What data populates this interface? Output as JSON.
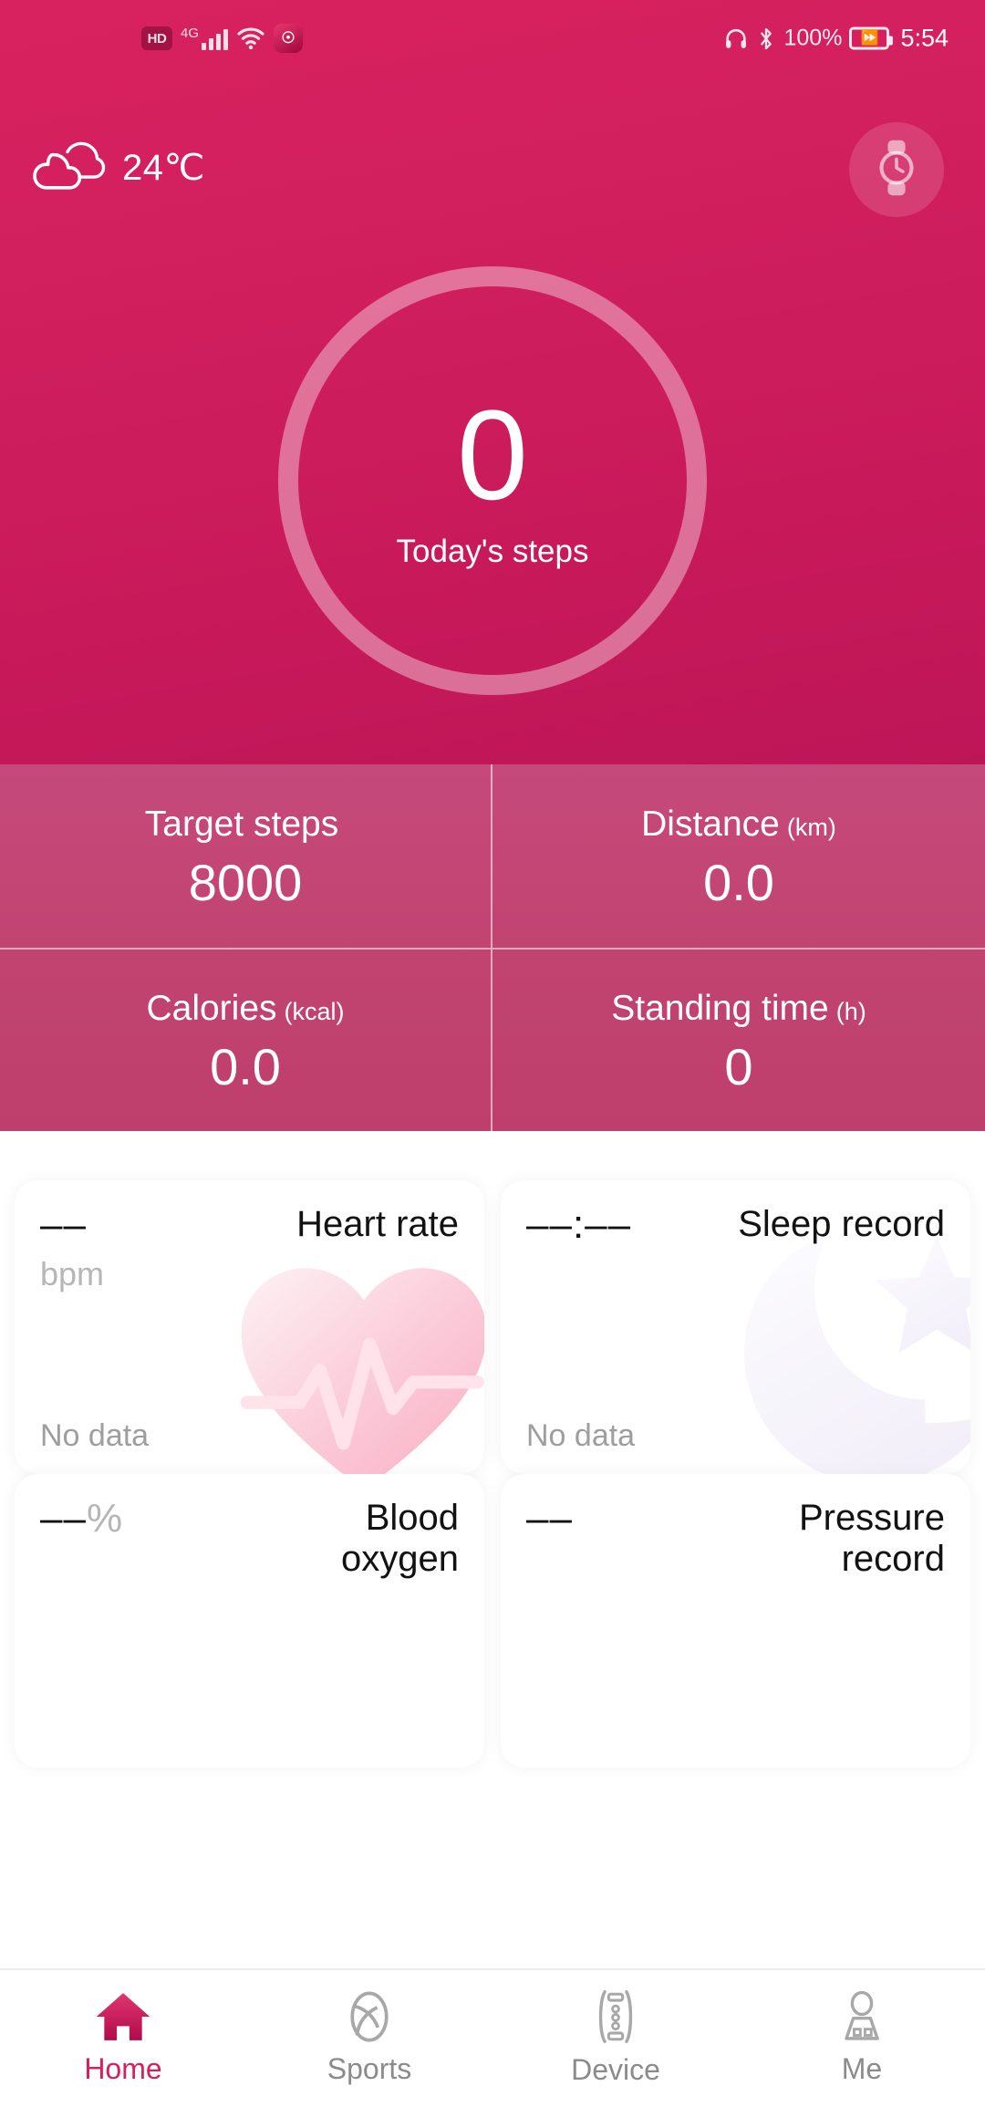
{
  "status_bar": {
    "hd_label": "HD",
    "network_label": "4G",
    "icons": [
      "hd-icon",
      "signal-bars-icon",
      "wifi-icon",
      "app-badge-icon",
      "headphones-icon",
      "bluetooth-icon"
    ],
    "battery_percent": "100%",
    "time": "5:54"
  },
  "header": {
    "weather_icon": "cloud-icon",
    "temperature": "24℃",
    "device_button_icon": "watch-icon"
  },
  "steps_ring": {
    "value": "0",
    "label": "Today's steps"
  },
  "stats": [
    {
      "title": "Target steps",
      "unit": "",
      "value": "8000"
    },
    {
      "title": "Distance",
      "unit": "(km)",
      "value": "0.0"
    },
    {
      "title": "Calories",
      "unit": "(kcal)",
      "value": "0.0"
    },
    {
      "title": "Standing time",
      "unit": "(h)",
      "value": "0"
    }
  ],
  "cards": [
    {
      "value": "––",
      "unit": "bpm",
      "title": "Heart rate",
      "empty_text": "No data",
      "art": "heart-ecg-icon"
    },
    {
      "value": "––:––",
      "unit": "",
      "title": "Sleep record",
      "empty_text": "No data",
      "art": "moon-star-icon"
    },
    {
      "value": "––",
      "unit_suffix": "%",
      "unit": "",
      "title": "Blood oxygen",
      "empty_text": "",
      "art": ""
    },
    {
      "value": "––",
      "unit": "",
      "title": "Pressure record",
      "empty_text": "",
      "art": ""
    }
  ],
  "tabbar": [
    {
      "label": "Home",
      "icon": "home-icon",
      "active": true
    },
    {
      "label": "Sports",
      "icon": "sports-ball-icon",
      "active": false
    },
    {
      "label": "Device",
      "icon": "wristband-icon",
      "active": false
    },
    {
      "label": "Me",
      "icon": "person-icon",
      "active": false
    }
  ],
  "colors": {
    "brand_pink": "#d61f5e",
    "hero_top": "#d8225f",
    "hero_bottom": "#bd1657",
    "stats_bg": "#c1436f",
    "muted_text": "#9e9e9e"
  }
}
